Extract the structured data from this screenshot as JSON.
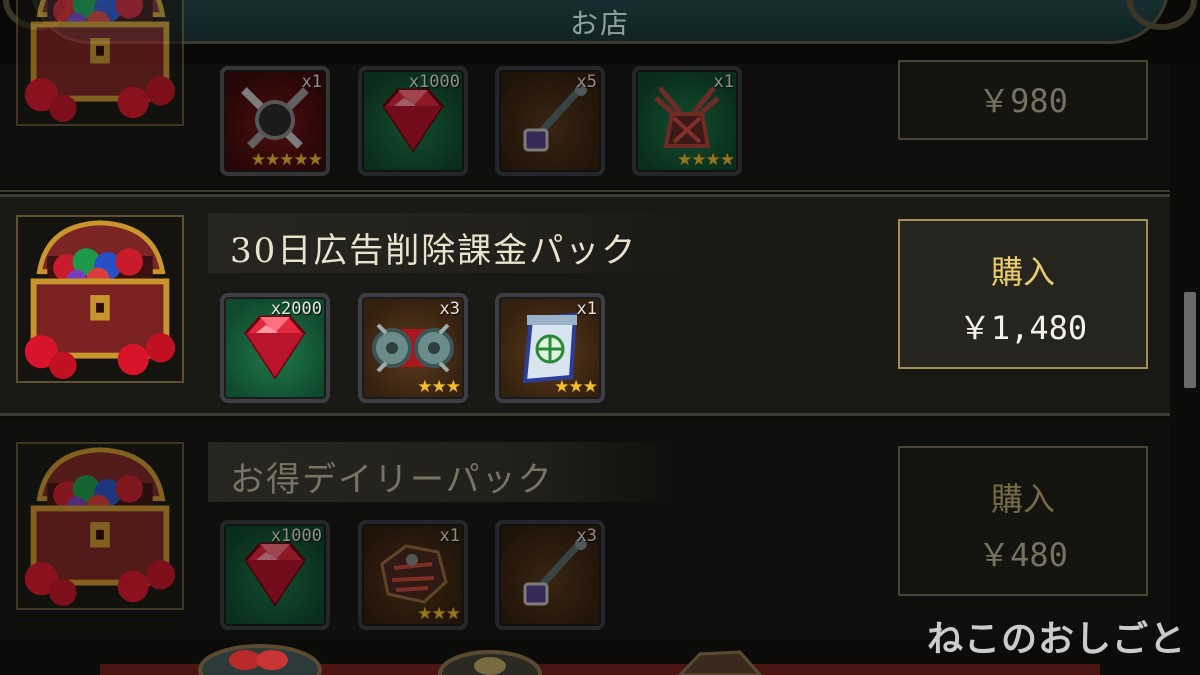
{
  "header": {
    "title": "お店"
  },
  "packs": [
    {
      "items": [
        {
          "icon": "crossed-swords-icon",
          "qty": "x1",
          "stars": "★★★★★"
        },
        {
          "icon": "ruby-gem-icon",
          "qty": "x1000",
          "stars": ""
        },
        {
          "icon": "key-staff-icon",
          "qty": "x5",
          "stars": ""
        },
        {
          "icon": "spider-creature-icon",
          "qty": "x1",
          "stars": "★★★★"
        }
      ],
      "price": "￥980"
    },
    {
      "title": "30日広告削除課金パック",
      "items": [
        {
          "icon": "ruby-gem-icon",
          "qty": "x2000",
          "stars": ""
        },
        {
          "icon": "spiked-roller-icon",
          "qty": "x3",
          "stars": "★★★"
        },
        {
          "icon": "magic-scroll-icon",
          "qty": "x1",
          "stars": "★★★"
        }
      ],
      "buy_label": "購入",
      "price": "￥1,480"
    },
    {
      "title": "お得デイリーパック",
      "items": [
        {
          "icon": "ruby-gem-icon",
          "qty": "x1000",
          "stars": ""
        },
        {
          "icon": "beast-armor-icon",
          "qty": "x1",
          "stars": "★★★"
        },
        {
          "icon": "key-staff-icon",
          "qty": "x3",
          "stars": ""
        }
      ],
      "buy_label": "購入",
      "price": "￥480"
    }
  ],
  "watermark": "ねこのおしごと",
  "colors": {
    "gem": "#d8223a",
    "star": "#f0bc30",
    "buy_highlight": "#e9cd6c",
    "frame_gold": "#a28f55"
  }
}
